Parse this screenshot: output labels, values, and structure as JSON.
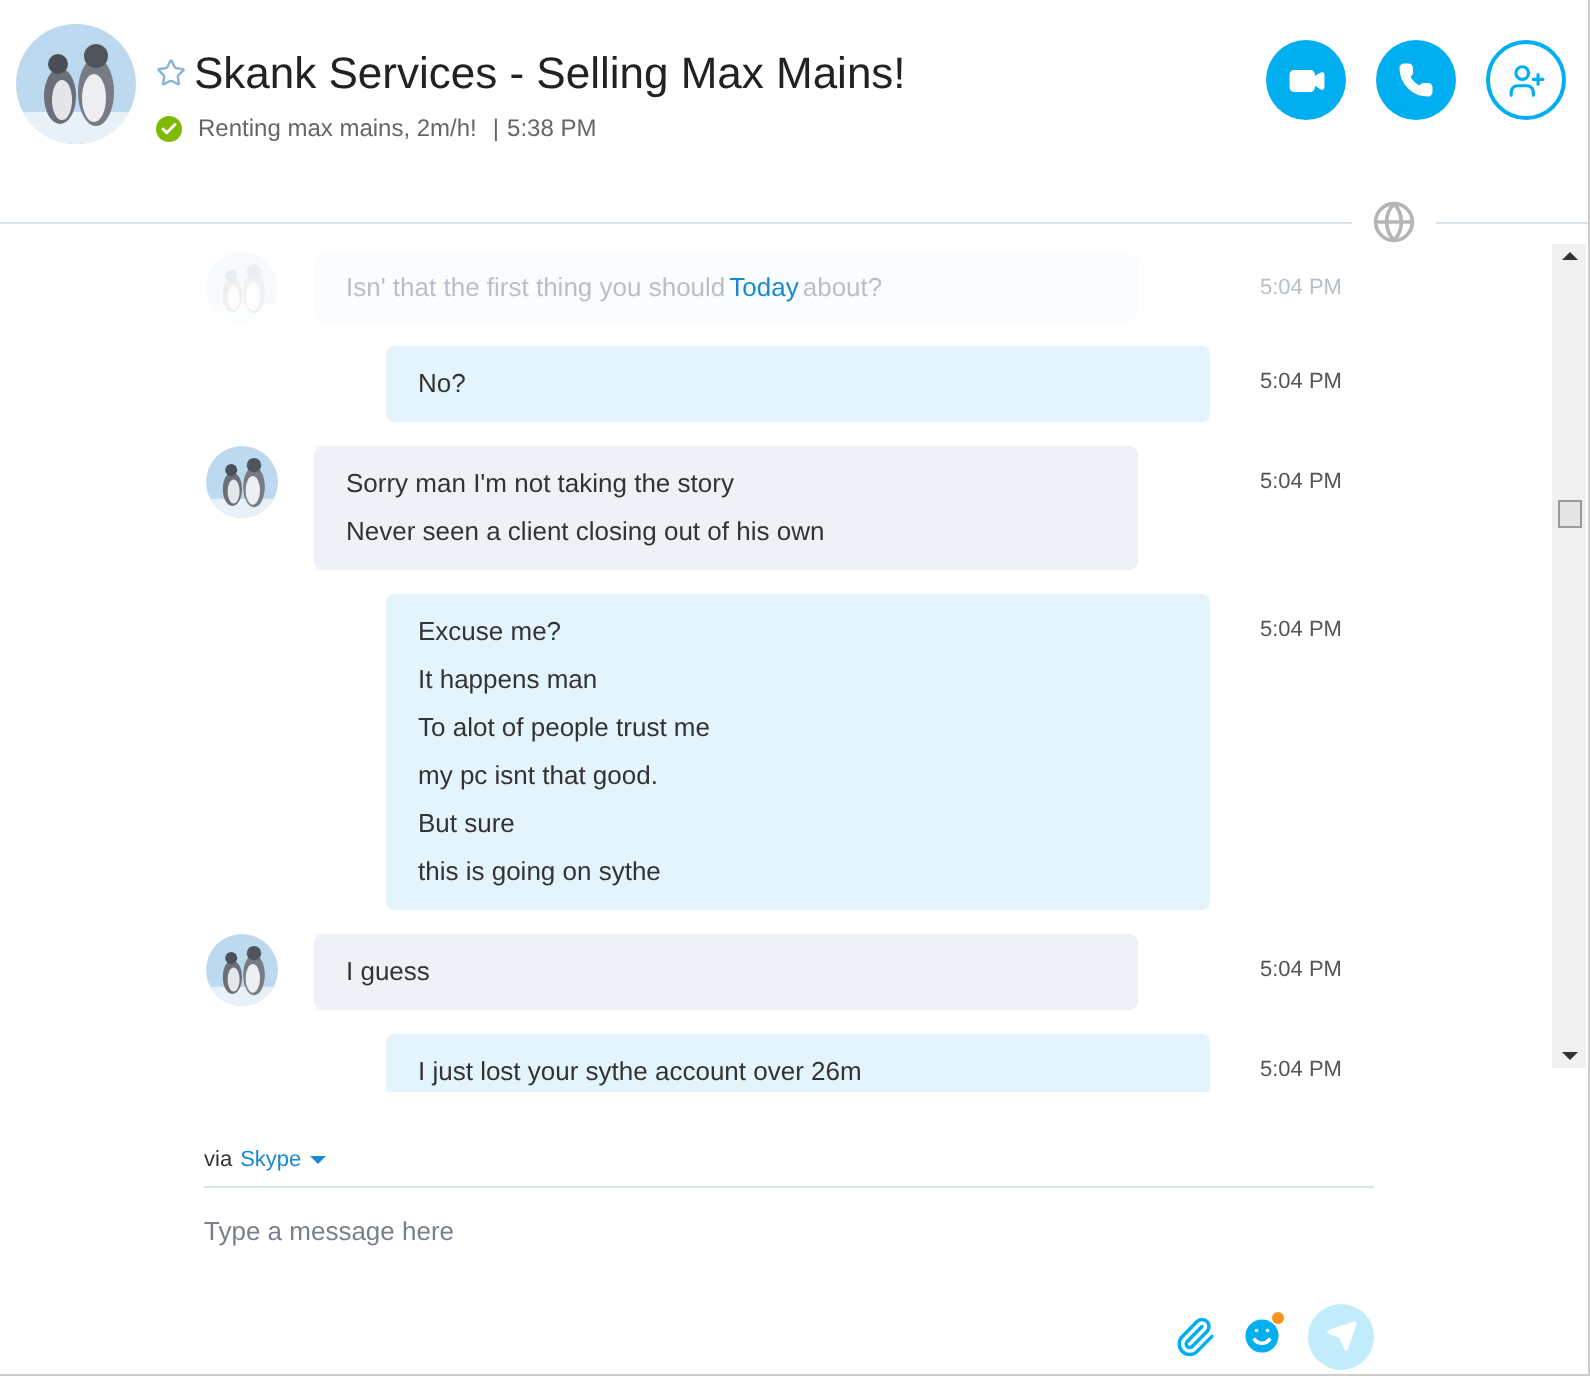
{
  "header": {
    "title": "Skank Services - Selling Max Mains!",
    "favorite": false,
    "status": "Renting max mains, 2m/h!",
    "separator": "|",
    "time": "5:38 PM"
  },
  "faded_message": {
    "text_before": "Isn' that the first thing you should",
    "date_label": "Today",
    "text_after": "about?",
    "time": "5:04 PM"
  },
  "messages": [
    {
      "kind": "outgoing",
      "lines": [
        "No?"
      ],
      "time": "5:04 PM"
    },
    {
      "kind": "incoming",
      "lines": [
        "Sorry man I'm not taking the story",
        "Never seen a client closing out of his own"
      ],
      "time": "5:04 PM"
    },
    {
      "kind": "outgoing",
      "lines": [
        "Excuse me?",
        "It happens man",
        "To alot of people trust me",
        "my pc isnt that good.",
        "But sure",
        "this is going on sythe"
      ],
      "time": "5:04 PM"
    },
    {
      "kind": "incoming",
      "lines": [
        "I guess"
      ],
      "time": "5:04 PM"
    },
    {
      "kind": "outgoing",
      "lines": [
        "I just lost your sythe account over 26m"
      ],
      "time": "5:04 PM"
    }
  ],
  "compose": {
    "via": "via",
    "service": "Skype",
    "placeholder": "Type a message here",
    "emoticon_notification": true
  }
}
